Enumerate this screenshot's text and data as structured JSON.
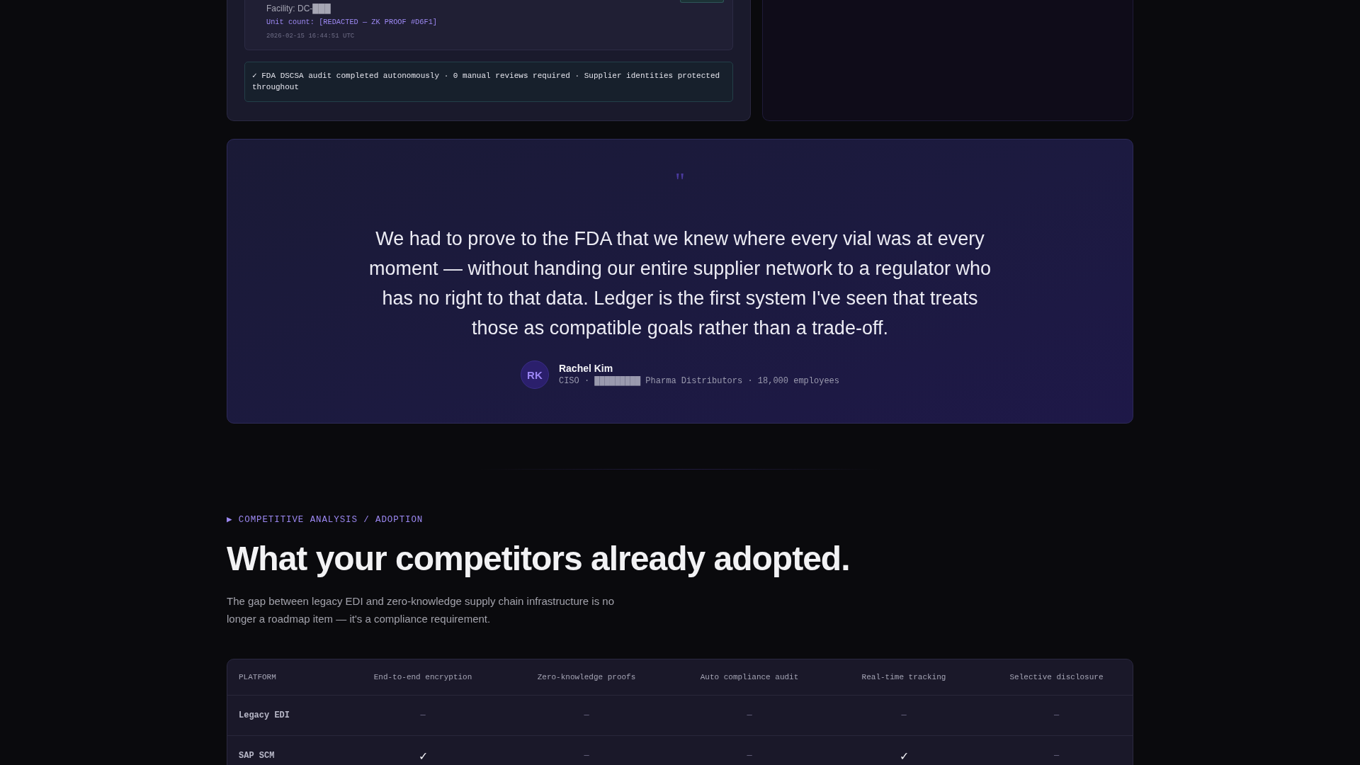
{
  "audit_card": {
    "record": {
      "facility": "Facility: DC-███",
      "unit_count": "Unit count: [REDACTED — ZK PROOF #D6F1]",
      "timestamp": "2026-02-15 16:44:51 UTC"
    },
    "result": "✓ FDA DSCSA audit completed autonomously · 0 manual reviews required · Supplier identities protected throughout"
  },
  "testimonial": {
    "quote_mark": "\"",
    "quote": "We had to prove to the FDA that we knew where every vial was at every moment — without handing our entire supplier network to a regulator who has no right to that data. Ledger is the first system I've seen that treats those as compatible goals rather than a trade-off.",
    "author": {
      "initials": "RK",
      "name": "Rachel Kim",
      "details": "CISO · █████████ Pharma Distributors · 18,000 employees"
    }
  },
  "section": {
    "eyebrow": "▶ COMPETITIVE ANALYSIS / ADOPTION",
    "heading": "What your competitors already adopted.",
    "intro": "The gap between legacy EDI and zero-knowledge supply chain infrastructure is no longer a roadmap item — it's a compliance requirement."
  },
  "comparison_table": {
    "columns": [
      "PLATFORM",
      "End-to-end encryption",
      "Zero-knowledge proofs",
      "Auto compliance audit",
      "Real-time tracking",
      "Selective disclosure"
    ],
    "rows": [
      {
        "cells": [
          {
            "kind": "platform",
            "text": "Legacy EDI"
          },
          {
            "kind": "none",
            "text": "—"
          },
          {
            "kind": "none",
            "text": "—"
          },
          {
            "kind": "none",
            "text": "—"
          },
          {
            "kind": "none",
            "text": "—"
          },
          {
            "kind": "none",
            "text": "—"
          }
        ]
      },
      {
        "cells": [
          {
            "kind": "platform",
            "text": "SAP SCM"
          },
          {
            "kind": "check",
            "text": "✓"
          },
          {
            "kind": "none",
            "text": "—"
          },
          {
            "kind": "none",
            "text": "—"
          },
          {
            "kind": "check",
            "text": "✓"
          },
          {
            "kind": "none",
            "text": "—"
          }
        ]
      }
    ]
  }
}
